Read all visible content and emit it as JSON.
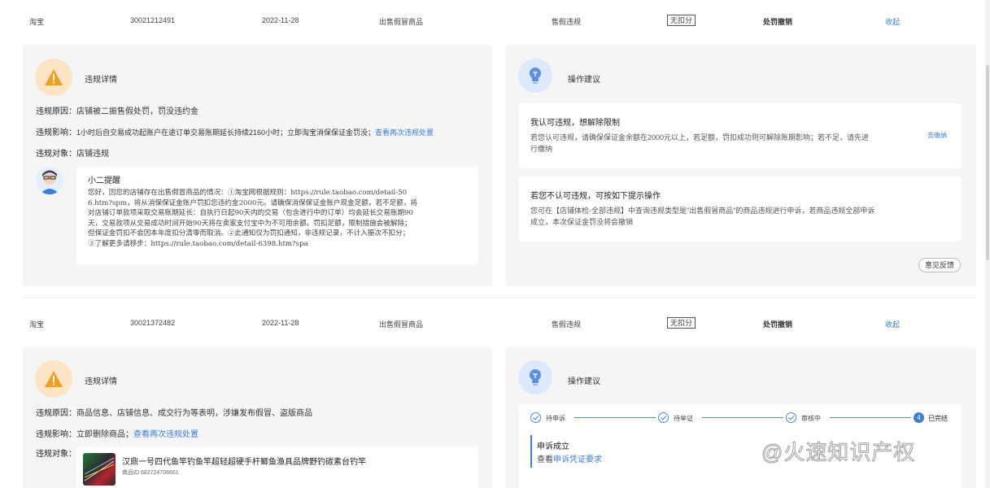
{
  "records": [
    {
      "platform": "淘宝",
      "order_id": "30021212491",
      "date": "2022-11-28",
      "reason_type": "出售假冒商品",
      "violation_type": "售假违规",
      "deduction_tag": "无扣分",
      "punishment": "处罚撤销",
      "collapse_label": "收起",
      "details": {
        "title": "违规详情",
        "reason_label": "违规原因：",
        "reason_value": "店铺被二振售假处罚，罚没违约金",
        "impact_label": "违规影响：",
        "impact_value": "1小时后自交易成功起账户在途订单交易账期延长持续2160小时；立即淘宝消保保证金罚没；",
        "impact_link": "查看再次违规处置",
        "target_label": "违规对象：",
        "target_value": "店铺违规",
        "xiaoer": {
          "title": "小二提醒",
          "lines": [
            "您好，因您的店铺存在出售假冒商品的情况：①淘宝网根据规则：https://rule.taobao.com/detail-50",
            "6.htm?spm，将从消保保证金账户罚扣您违约金2000元。请确保消保保证金账户现金足额，若不足额，将",
            "对店铺订单款项采取交易账期延长：自执行日起90天内的交易（包含进行中的订单）均会延长交易账期90",
            "天，交易款项从交易成功时间开始90天将在卖家支付宝中为不可用余额。罚扣足额，限制措施会被解除；",
            "但保证金罚扣不会因本年度扣分清零而取消。②此通知仅为罚扣通知，非违规记录，不计入振次不扣分；",
            "③了解更多请移步：https://rule.taobao.com/detail-6398.htm?spa"
          ]
        }
      },
      "advice": {
        "title": "操作建议",
        "card1_title": "我认可违规，想解除限制",
        "card1_lines": [
          "若您认可违规，请确保保证金余额在2000元以上，若足额，罚扣成功则可解除账期影响；若不足，请先进",
          "行缴纳"
        ],
        "card1_link": "去缴纳",
        "card2_title": "若您不认可违规，可按如下提示操作",
        "card2_lines": [
          "您可在【店铺体检-全部违规】中查询违规类型是\"出售假冒商品\"的商品违规进行申诉，若商品违规全部申诉",
          "成立，本次保证金罚没将会撤销"
        ],
        "feedback_label": "意见反馈"
      }
    },
    {
      "platform": "淘宝",
      "order_id": "30021372482",
      "date": "2022-11-28",
      "reason_type": "出售假冒商品",
      "violation_type": "售假违规",
      "deduction_tag": "无扣分",
      "punishment": "处罚撤销",
      "collapse_label": "收起",
      "details": {
        "title": "违规详情",
        "reason_label": "违规原因：",
        "reason_value": "商品信息、店铺信息、成交行为等表明，涉嫌发布假冒、盗版商品",
        "impact_label": "违规影响：",
        "impact_value": "立即删除商品；",
        "impact_link": "查看再次违规处置",
        "target_label": "违规对象：",
        "product_name": "汉鼎一号四代鱼竿钓鱼竿超轻超硬手杆鲫鱼渔具品牌野钓碳素台钓竿",
        "product_id": "商品ID 682724706661"
      },
      "advice": {
        "title": "操作建议",
        "steps": [
          "待申诉",
          "待举证",
          "审核中",
          "已完结"
        ],
        "final_step_number": "4",
        "result_title": "申诉成立",
        "result_prefix": "查看",
        "result_link": "申诉凭证要求"
      }
    }
  ],
  "watermark": "@火速知识产权",
  "colors": {
    "link": "#3b7fd6",
    "warning_bg": "#fde4c4",
    "warning_icon": "#f0a020",
    "bulb_bg": "#dce8fb",
    "bulb_icon": "#5b8fe0"
  }
}
